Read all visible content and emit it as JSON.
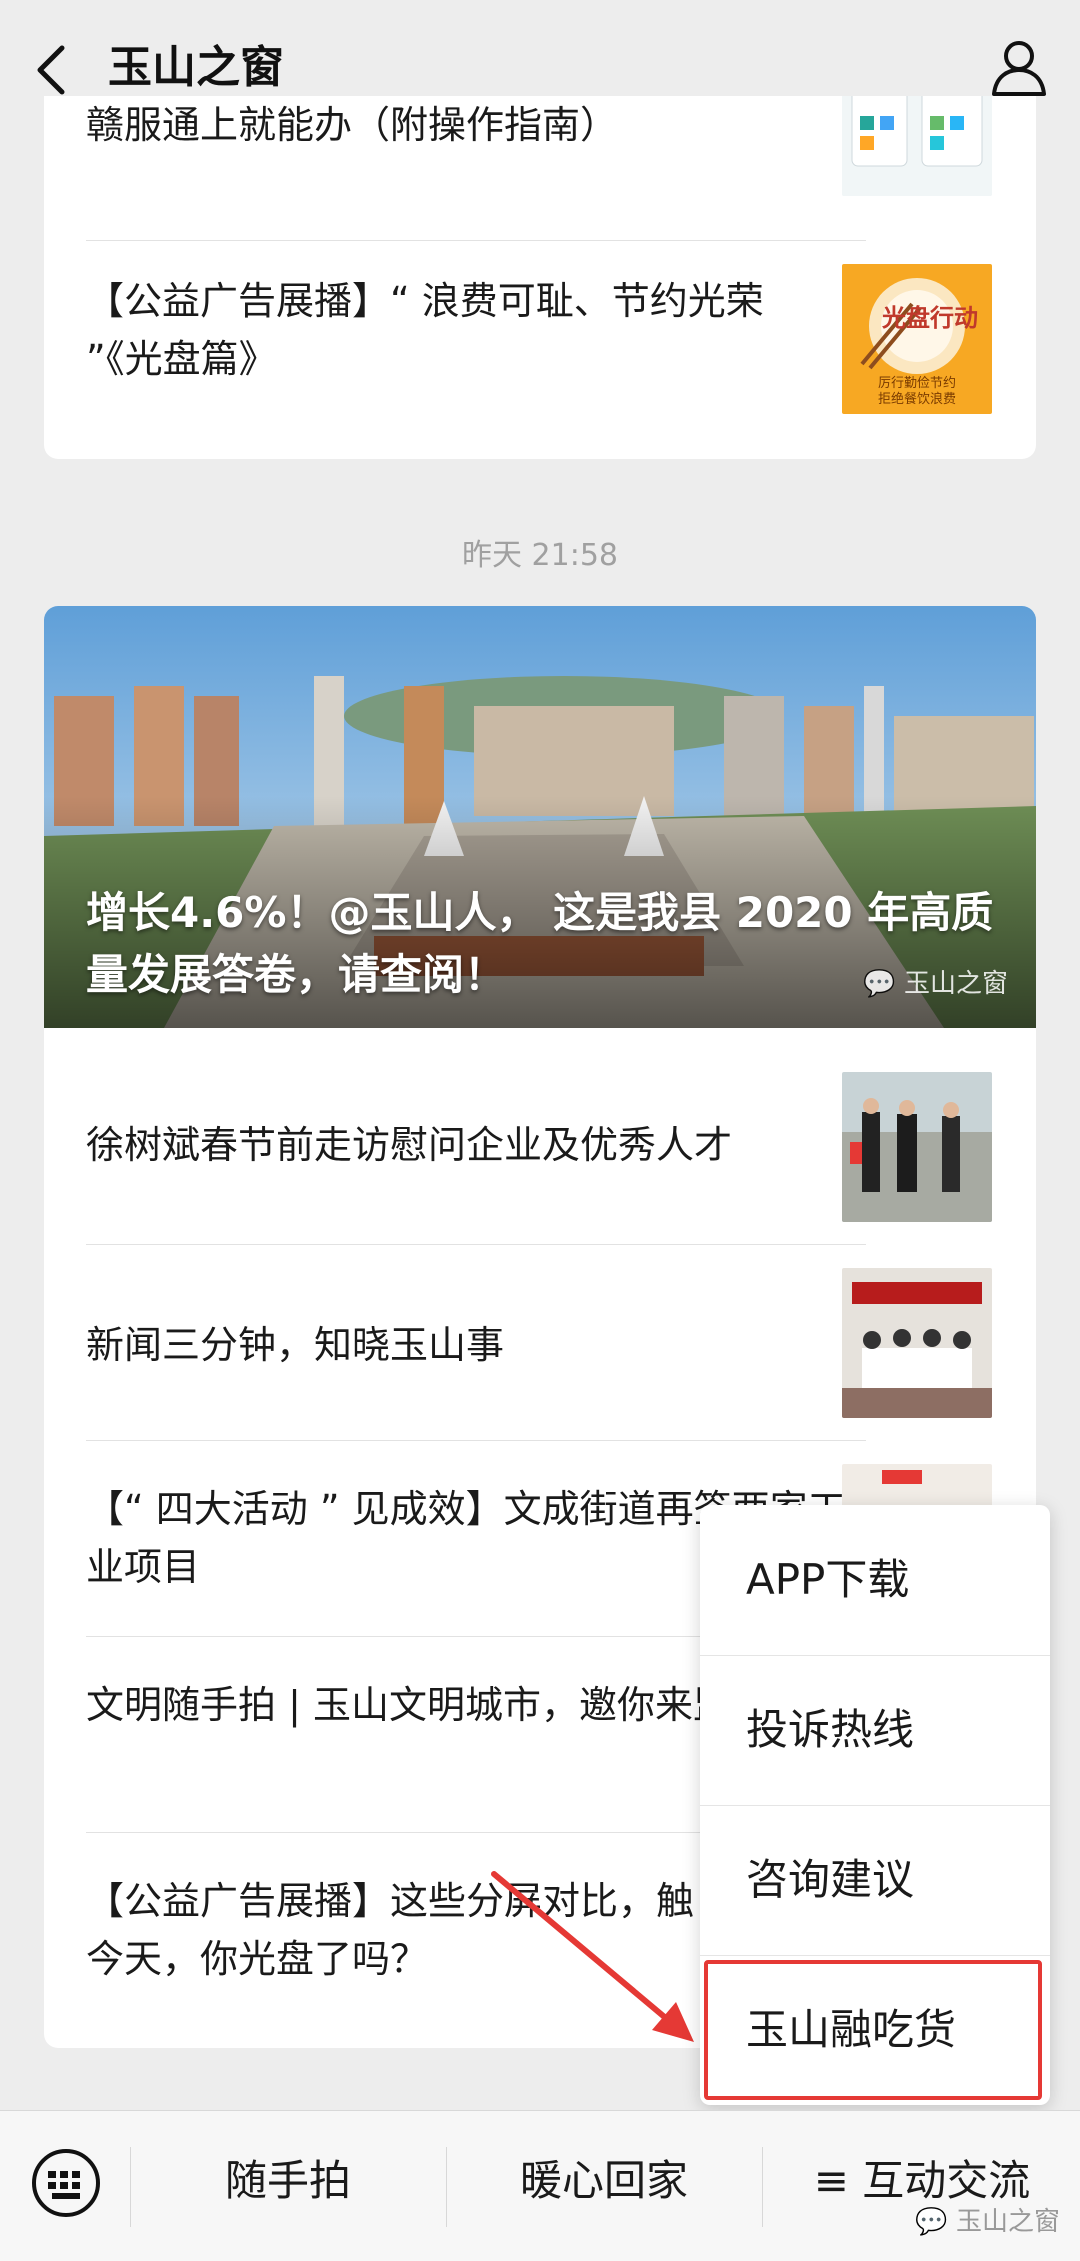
{
  "header": {
    "title": "玉山之窗"
  },
  "top_card": {
    "items": [
      {
        "text": "赣服通上就能办（附操作指南）"
      },
      {
        "text": "【公益广告展播】“ 浪费可耻、节约光荣 ”《光盘篇》"
      }
    ],
    "thumb_text": "光盘行动",
    "thumb_caption_1": "厉行勤俭节约",
    "thumb_caption_2": "拒绝餐饮浪费"
  },
  "timestamp": "昨天 21:58",
  "main_card": {
    "hero_title": "增长4.6%！@玉山人， 这是我县 2020 年高质量发展答卷，请查阅！",
    "hero_watermark": "玉山之窗",
    "items": [
      {
        "text": "徐树斌春节前走访慰问企业及优秀人才"
      },
      {
        "text": "新闻三分钟，知晓玉山事"
      },
      {
        "text": "【“ 四大活动 ” 见成效】文成街道再签两家工业项目"
      },
      {
        "text": "文明随手拍 | 玉山文明城市，邀你来监督！"
      },
      {
        "text": "【公益广告展播】这些分屏对比，触目惊心！今天，你光盘了吗？"
      }
    ]
  },
  "popup_menu": {
    "items": [
      {
        "label": "APP下载"
      },
      {
        "label": "投诉热线"
      },
      {
        "label": "咨询建议"
      },
      {
        "label": "玉山融吃货"
      }
    ]
  },
  "bottom_bar": {
    "tabs": [
      {
        "label": "随手拍"
      },
      {
        "label": "暖心回家"
      },
      {
        "label": "≡ 互动交流"
      }
    ],
    "watermark": "玉山之窗"
  },
  "colors": {
    "highlight": "#e53935",
    "background": "#ededed"
  }
}
